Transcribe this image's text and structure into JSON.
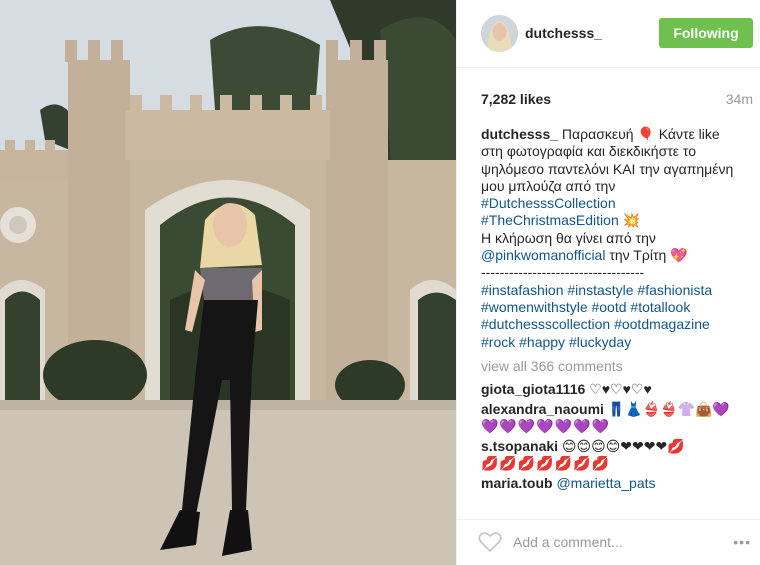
{
  "post": {
    "username": "dutchesss_",
    "follow_label": "Following",
    "likes": "7,282 likes",
    "time": "34m"
  },
  "caption": {
    "user": "dutchesss_",
    "line1": " Παρασκευή 🎈 Κάντε like",
    "line2": "στη φωτογραφία και διεκδικήστε το",
    "line3": "ψηλόμεσο παντελόνι ΚΑΙ την αγαπημένη",
    "line4": "μου μπλούζα από την",
    "tag1": "#DutchesssCollection",
    "tag2": "#TheChristmasEdition",
    "tag2_emoji": " 💥",
    "line7": "Η κλήρωση θα γίνει από την",
    "mention": "@pinkwomanofficial",
    "line8_rest": " την Τρίτη 💖",
    "divider": "-----------------------------------",
    "hashtags_line1": "#instafashion #instastyle #fashionista",
    "hashtags_line2": "#womenwithstyle #ootd #totallook",
    "hashtags_line3": "#dutchessscollection #ootdmagazine",
    "hashtags_line4": "#rock #happy #luckyday"
  },
  "view_all": "view all 366 comments",
  "comments": [
    {
      "user": "giota_giota1116",
      "text": " ♡♥♡♥♡♥"
    },
    {
      "user": "alexandra_naoumi",
      "text": " 👖👗👙👙👚👜💜",
      "text2": "💜💜💜💜💜💜💜"
    },
    {
      "user": "s.tsopanaki",
      "text": " 😊😊😊😊❤❤❤❤💋",
      "text2": "💋💋💋💋💋💋💋"
    },
    {
      "user": "maria.toub",
      "mention": "@marietta_pats"
    }
  ],
  "footer": {
    "add_comment_placeholder": "Add a comment...",
    "more": "•••"
  },
  "icons": {
    "like": "heart-outline-icon",
    "more": "ellipsis-icon"
  },
  "colors": {
    "follow_button": "#70c050",
    "link": "#125688",
    "muted": "#999999"
  }
}
